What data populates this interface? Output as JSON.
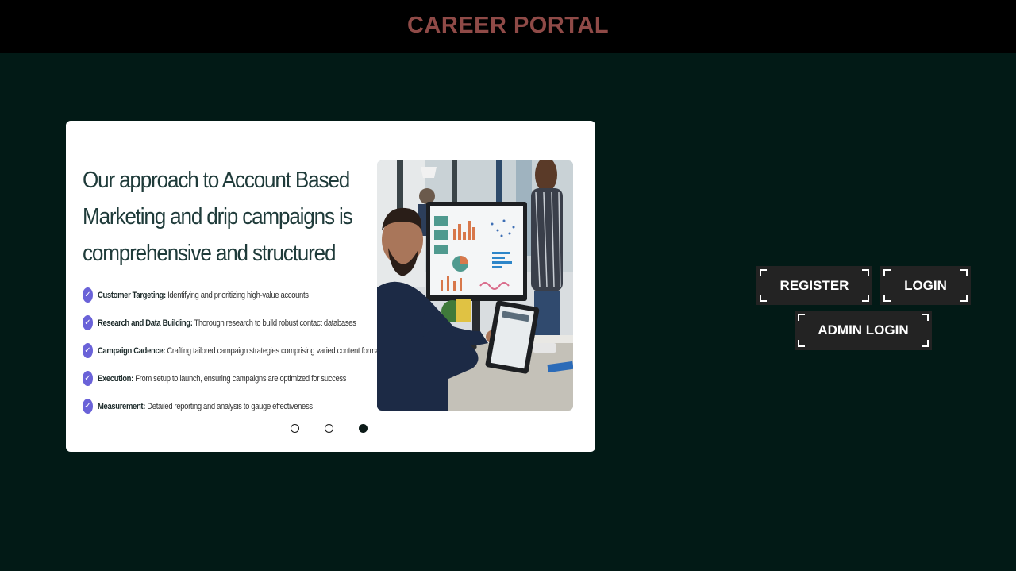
{
  "header": {
    "title": "CAREER PORTAL",
    "title_color": "#8f4a47"
  },
  "colors": {
    "background": "#021a16",
    "topbar": "#000000",
    "button": "#232323",
    "check_accent": "#6a62d8"
  },
  "carousel": {
    "heading_lines": [
      "Our approach to Account Based",
      "Marketing and drip campaigns is",
      "comprehensive and structured"
    ],
    "bullets": [
      {
        "bold": "Customer Targeting:",
        "text": " Identifying and prioritizing high-value accounts"
      },
      {
        "bold": "Research and Data Building:",
        "text": " Thorough research to build robust contact databases"
      },
      {
        "bold": "Campaign Cadence:",
        "text": " Crafting tailored campaign strategies comprising varied content formats"
      },
      {
        "bold": "Execution:",
        "text": " From setup to launch, ensuring campaigns are optimized for success"
      },
      {
        "bold": "Measurement:",
        "text": " Detailed reporting and analysis to gauge effectiveness"
      }
    ],
    "check_icon": "check-circle-icon",
    "slide_count": 3,
    "active_slide": 3
  },
  "actions": {
    "register_label": "REGISTER",
    "login_label": "LOGIN",
    "admin_login_label": "ADMIN LOGIN"
  }
}
